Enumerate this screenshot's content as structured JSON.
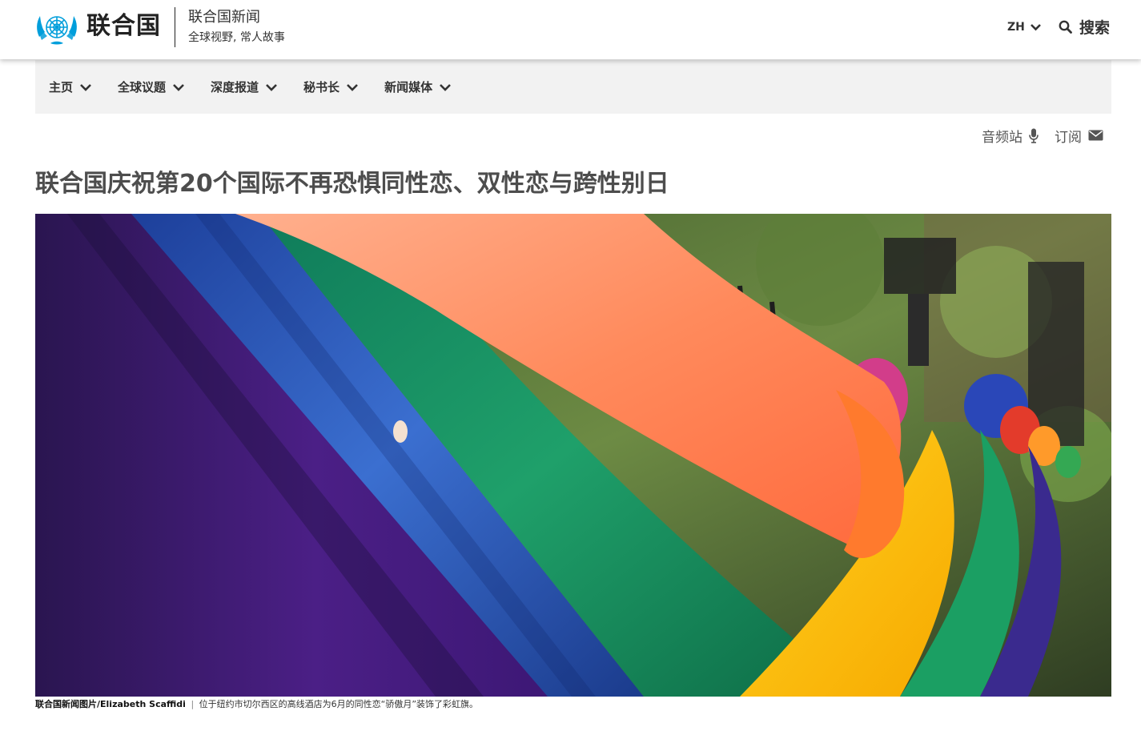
{
  "header": {
    "logo_text": "联合国",
    "site_title": "联合国新闻",
    "site_tagline": "全球视野, 常人故事",
    "language": "ZH",
    "search_label": "搜索"
  },
  "nav": {
    "items": [
      {
        "label": "主页"
      },
      {
        "label": "全球议题"
      },
      {
        "label": "深度报道"
      },
      {
        "label": "秘书长"
      },
      {
        "label": "新闻媒体"
      }
    ]
  },
  "utility": {
    "audio_label": "音频站",
    "subscribe_label": "订阅"
  },
  "article": {
    "headline": "联合国庆祝第20个国际不再恐惧同性恋、双性恋与跨性别日",
    "image_credit": "联合国新闻图片/Elizabeth Scaffidi",
    "image_caption_separator": "|",
    "image_caption": "位于纽约市切尔西区的高线酒店为6月的同性恋“骄傲月”装饰了彩虹旗。"
  },
  "icons": {
    "logo": "un-emblem-icon",
    "language_chevron": "chevron-down-icon",
    "search": "search-icon",
    "nav_chevron": "chevron-down-icon",
    "audio": "microphone-icon",
    "subscribe": "envelope-icon"
  },
  "colors": {
    "un_blue": "#009edb",
    "nav_background": "#f2f2f2",
    "headline": "#4d4d4d"
  }
}
